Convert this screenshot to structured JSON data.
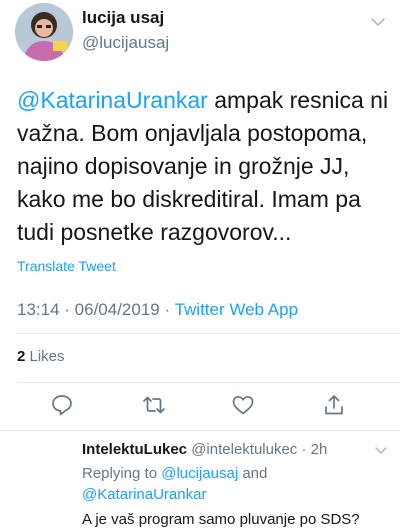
{
  "tweet": {
    "author_name": "lucija usaj",
    "author_handle": "@lucijausaj",
    "mention": "@KatarinaUrankar",
    "text": " ampak resnica ni važna. Bom onjavljala postopoma, najino dopisovanje in grožnje JJ, kako me bo diskreditiral. Imam pa tudi posnetke razgovorov...",
    "translate_label": "Translate Tweet",
    "time": "13:14",
    "separator": " · ",
    "date": "06/04/2019",
    "source": "Twitter Web App",
    "likes_count": "2",
    "likes_label": " Likes"
  },
  "actions": {
    "icons": [
      "comment-icon",
      "retweet-icon",
      "heart-icon",
      "share-icon"
    ]
  },
  "reply": {
    "author_name": "IntelektuLukec",
    "author_handle": " @intelektulukec",
    "time": "2h",
    "separator": " · ",
    "replying_prefix": "Replying to ",
    "mention_1": "@lucijausaj",
    "and_word": " and",
    "mention_2": "@KatarinaUrankar",
    "text": "A je vaš program samo pluvanje po SDS?"
  },
  "colors": {
    "accent": "#1da1f2",
    "secondary_text": "#657786",
    "primary_text": "#14171a",
    "divider": "#e1e8ed"
  }
}
